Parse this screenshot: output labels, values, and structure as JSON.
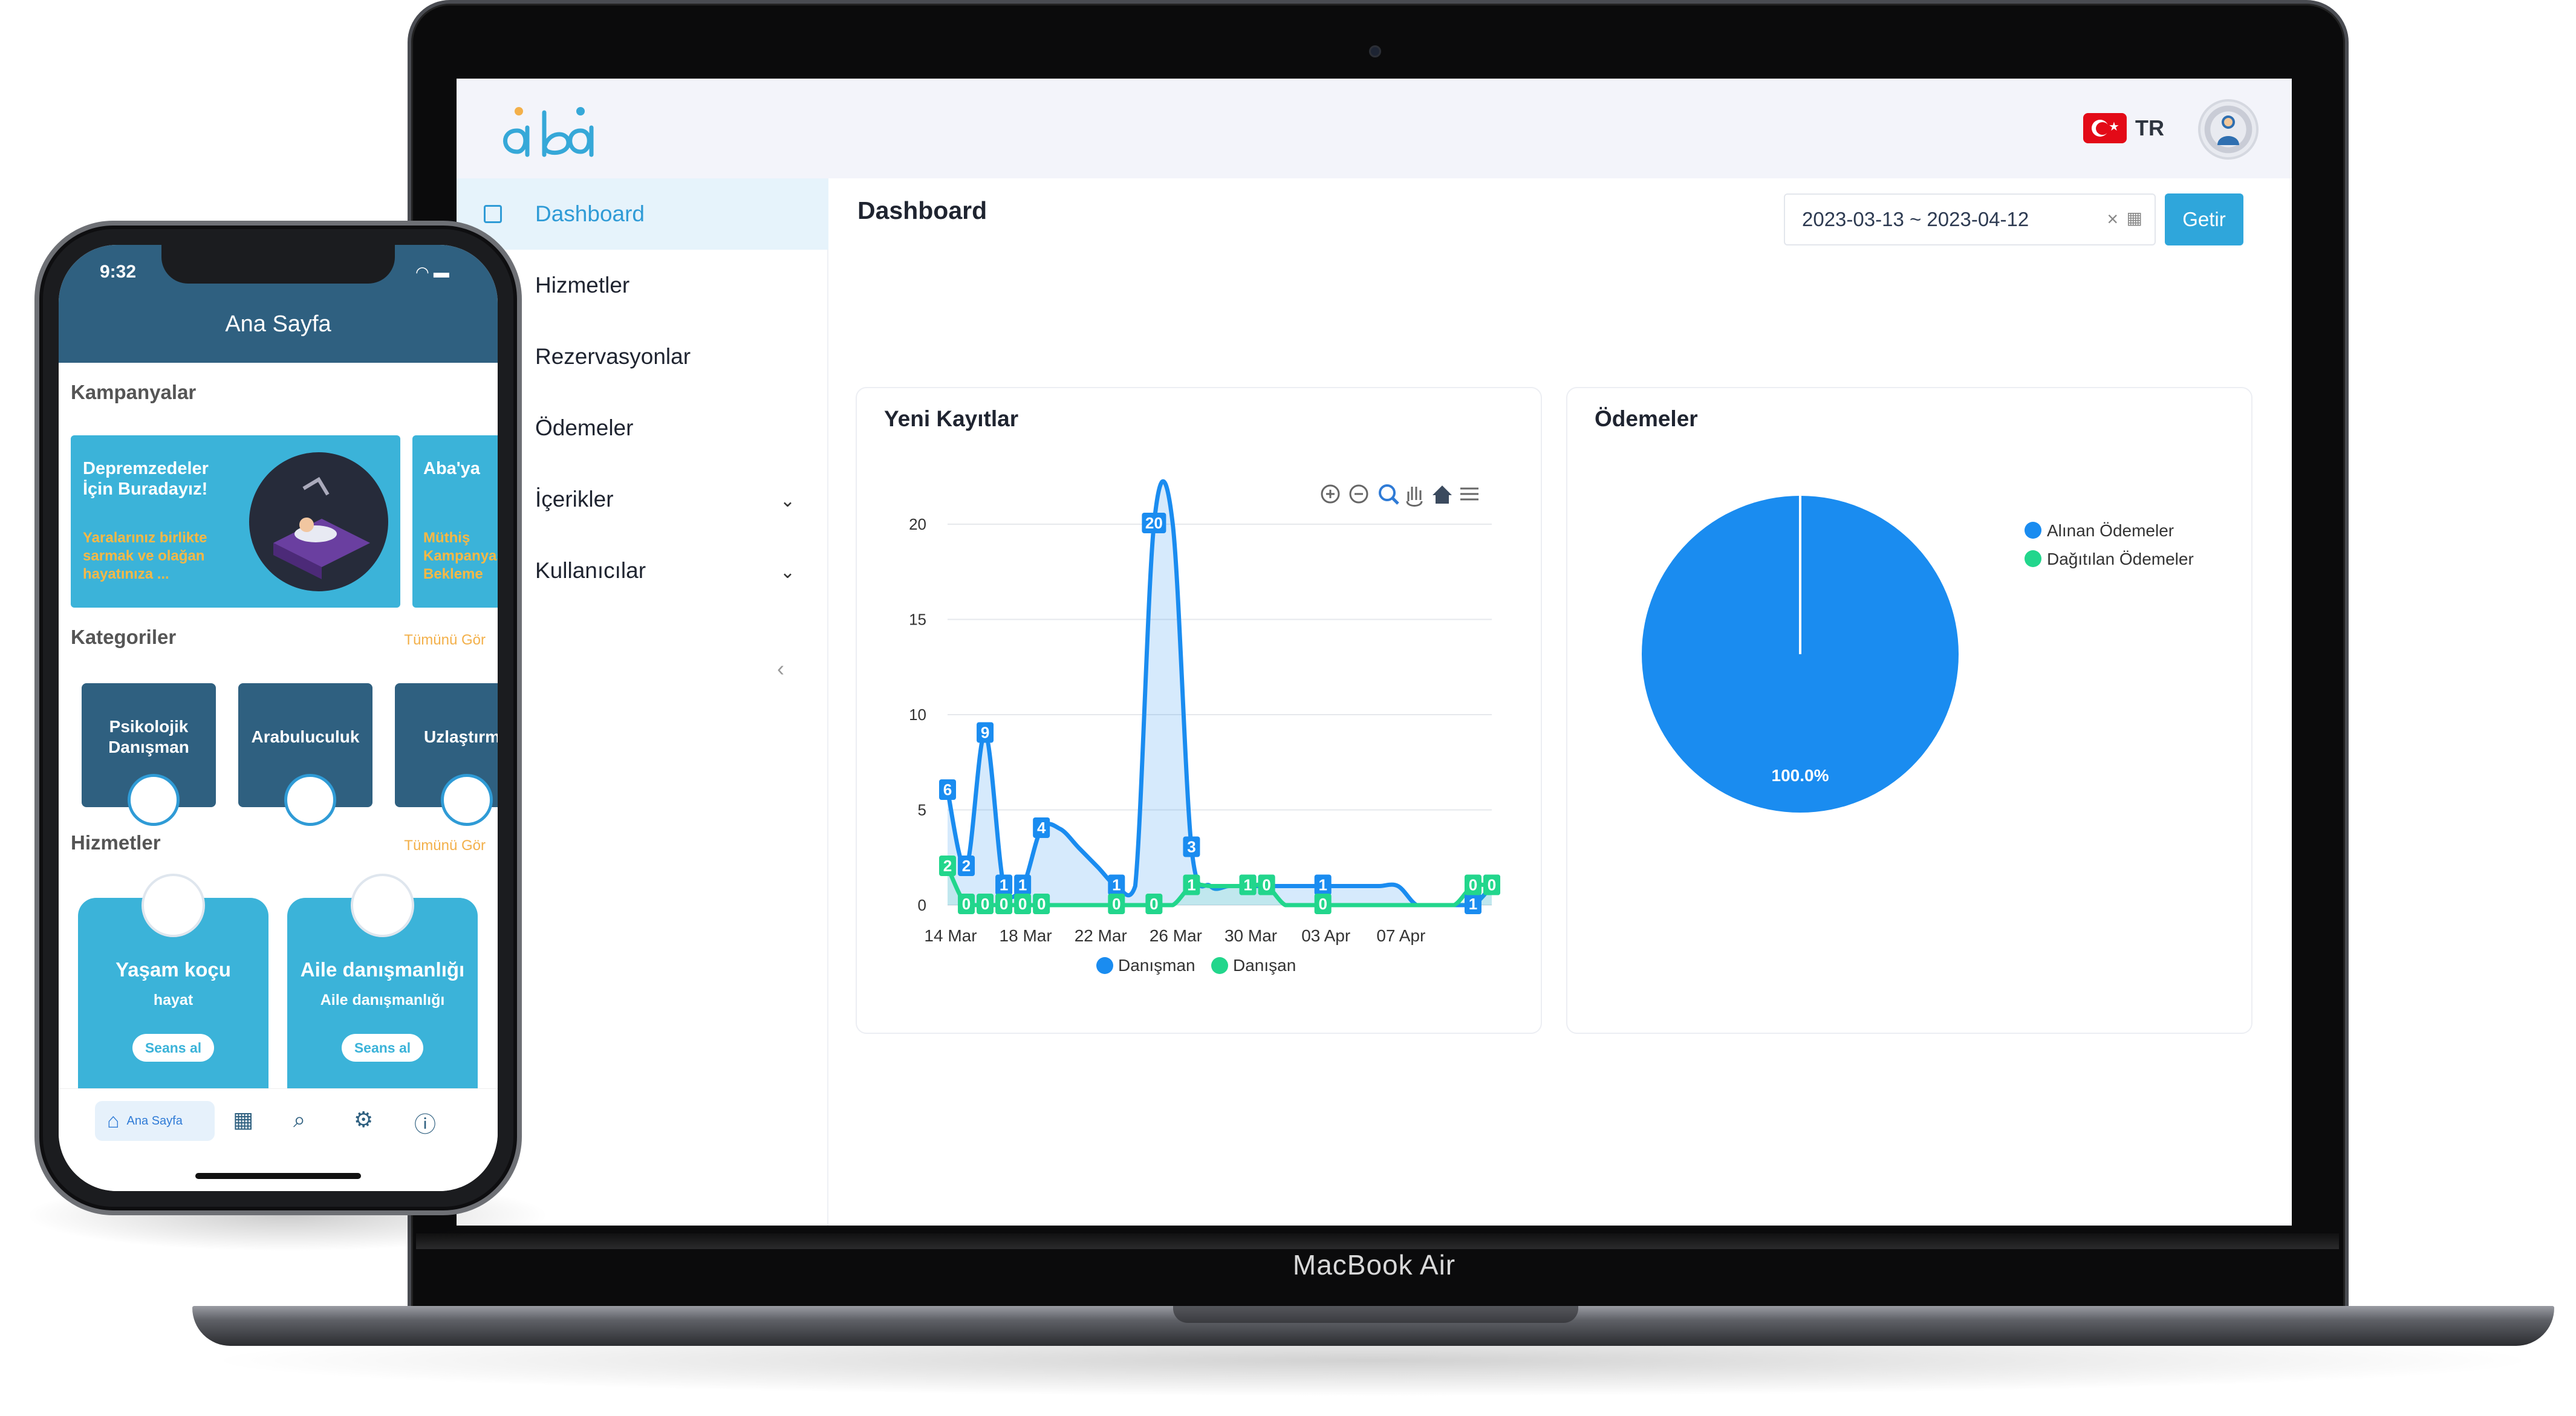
{
  "laptop": {
    "brand_label": "MacBook Air"
  },
  "app": {
    "language": "TR",
    "sidebar": {
      "items": [
        {
          "label": "Dashboard"
        },
        {
          "label": "Hizmetler"
        },
        {
          "label": "Rezervasyonlar"
        },
        {
          "label": "Ödemeler"
        },
        {
          "label": "İçerikler"
        },
        {
          "label": "Kullanıcılar"
        }
      ]
    },
    "page_title": "Dashboard",
    "date_range": "2023-03-13 ~ 2023-04-12",
    "fetch_button": "Getir",
    "colors": {
      "accent": "#2fa6db",
      "series_blue": "#1a8cf0",
      "series_green": "#22d68c"
    }
  },
  "chart_data": [
    {
      "type": "area",
      "title": "Yeni Kayıtlar",
      "x_tick_labels": [
        "14 Mar",
        "18 Mar",
        "22 Mar",
        "26 Mar",
        "30 Mar",
        "03 Apr",
        "07 Apr"
      ],
      "ylim": [
        0,
        20
      ],
      "y_ticks": [
        0,
        5,
        10,
        15,
        20
      ],
      "grid": true,
      "legend_position": "bottom",
      "series": [
        {
          "name": "Danışman",
          "color": "#1a8cf0",
          "x": [
            0,
            1,
            2,
            3,
            4,
            5,
            6,
            7,
            8,
            9,
            10,
            11,
            12,
            13,
            14,
            15,
            16,
            17,
            18,
            19,
            20,
            21,
            22,
            23,
            24,
            25,
            26,
            27,
            28,
            29
          ],
          "values": [
            6,
            2,
            9,
            1,
            1,
            4,
            4,
            3,
            2,
            1,
            1,
            20,
            20,
            3,
            1,
            1,
            1,
            1,
            1,
            1,
            1,
            1,
            1,
            1,
            1,
            0,
            0,
            0,
            0,
            1
          ]
        },
        {
          "name": "Danışan",
          "color": "#22d68c",
          "x": [
            0,
            1,
            2,
            3,
            4,
            5,
            6,
            7,
            8,
            9,
            10,
            11,
            12,
            13,
            14,
            15,
            16,
            17,
            18,
            19,
            20,
            21,
            22,
            23,
            24,
            25,
            26,
            27,
            28,
            29
          ],
          "values": [
            2,
            0,
            0,
            0,
            0,
            0,
            0,
            0,
            0,
            0,
            0,
            0,
            0,
            1,
            1,
            1,
            1,
            1,
            0,
            0,
            0,
            0,
            0,
            0,
            0,
            0,
            0,
            0,
            1,
            1
          ]
        }
      ],
      "data_labels": [
        {
          "series": "Danışman",
          "x": 0,
          "value": "6"
        },
        {
          "series": "Danışman",
          "x": 1,
          "value": "2"
        },
        {
          "series": "Danışman",
          "x": 2,
          "value": "9"
        },
        {
          "series": "Danışman",
          "x": 3,
          "value": "1"
        },
        {
          "series": "Danışman",
          "x": 4,
          "value": "1"
        },
        {
          "series": "Danışman",
          "x": 5,
          "value": "4"
        },
        {
          "series": "Danışman",
          "x": 9,
          "value": "1"
        },
        {
          "series": "Danışman",
          "x": 11,
          "value": "20"
        },
        {
          "series": "Danışman",
          "x": 13,
          "value": "3"
        },
        {
          "series": "Danışman",
          "x": 16,
          "value": "1"
        },
        {
          "series": "Danışman",
          "x": 17,
          "value": "1"
        },
        {
          "series": "Danışman",
          "x": 20,
          "value": "1"
        },
        {
          "series": "Danışman",
          "x": 28,
          "value": "1"
        },
        {
          "series": "Danışman",
          "x": 29,
          "value": "1"
        },
        {
          "series": "Danışan",
          "x": 0,
          "value": "2"
        },
        {
          "series": "Danışan",
          "x": 1,
          "value": "0"
        },
        {
          "series": "Danışan",
          "x": 2,
          "value": "0"
        },
        {
          "series": "Danışan",
          "x": 3,
          "value": "0"
        },
        {
          "series": "Danışan",
          "x": 4,
          "value": "0"
        },
        {
          "series": "Danışan",
          "x": 5,
          "value": "0"
        },
        {
          "series": "Danışan",
          "x": 9,
          "value": "0"
        },
        {
          "series": "Danışan",
          "x": 11,
          "value": "0"
        },
        {
          "series": "Danışan",
          "x": 13,
          "value": "1"
        },
        {
          "series": "Danışan",
          "x": 16,
          "value": "1"
        },
        {
          "series": "Danışan",
          "x": 17,
          "value": "0"
        },
        {
          "series": "Danışan",
          "x": 20,
          "value": "0"
        },
        {
          "series": "Danışan",
          "x": 28,
          "value": "0"
        },
        {
          "series": "Danışan",
          "x": 29,
          "value": "0"
        }
      ]
    },
    {
      "type": "pie",
      "title": "Ödemeler",
      "legend_position": "top-right",
      "slices": [
        {
          "name": "Alınan Ödemeler",
          "value": 100.0,
          "label": "100.0%",
          "color": "#1a8cf0"
        },
        {
          "name": "Dağıtılan Ödemeler",
          "value": 0.0,
          "color": "#22d68c"
        }
      ]
    }
  ],
  "phone": {
    "time": "9:32",
    "header_title": "Ana Sayfa",
    "sections": {
      "campaigns": "Kampanyalar",
      "categories": "Kategoriler",
      "services": "Hizmetler",
      "see_all": "Tümünü Gör"
    },
    "campaigns": [
      {
        "title": "Depremzedeler İçin Buradayız!",
        "text": "Yaralarınız birlikte sarmak ve olağan hayatınıza ..."
      },
      {
        "title": "Aba'ya",
        "text": "Müthiş Kampanyası Bekleme"
      }
    ],
    "categories": [
      {
        "label": "Psikolojik Danışman"
      },
      {
        "label": "Arabuluculuk"
      },
      {
        "label": "Uzlaştırm"
      }
    ],
    "services": [
      {
        "title": "Yaşam koçu",
        "subtitle": "hayat",
        "button": "Seans al"
      },
      {
        "title": "Aile danışmanlığı",
        "subtitle": "Aile danışmanlığı",
        "button": "Seans al"
      }
    ],
    "tabbar": {
      "home_label": "Ana Sayfa"
    }
  }
}
